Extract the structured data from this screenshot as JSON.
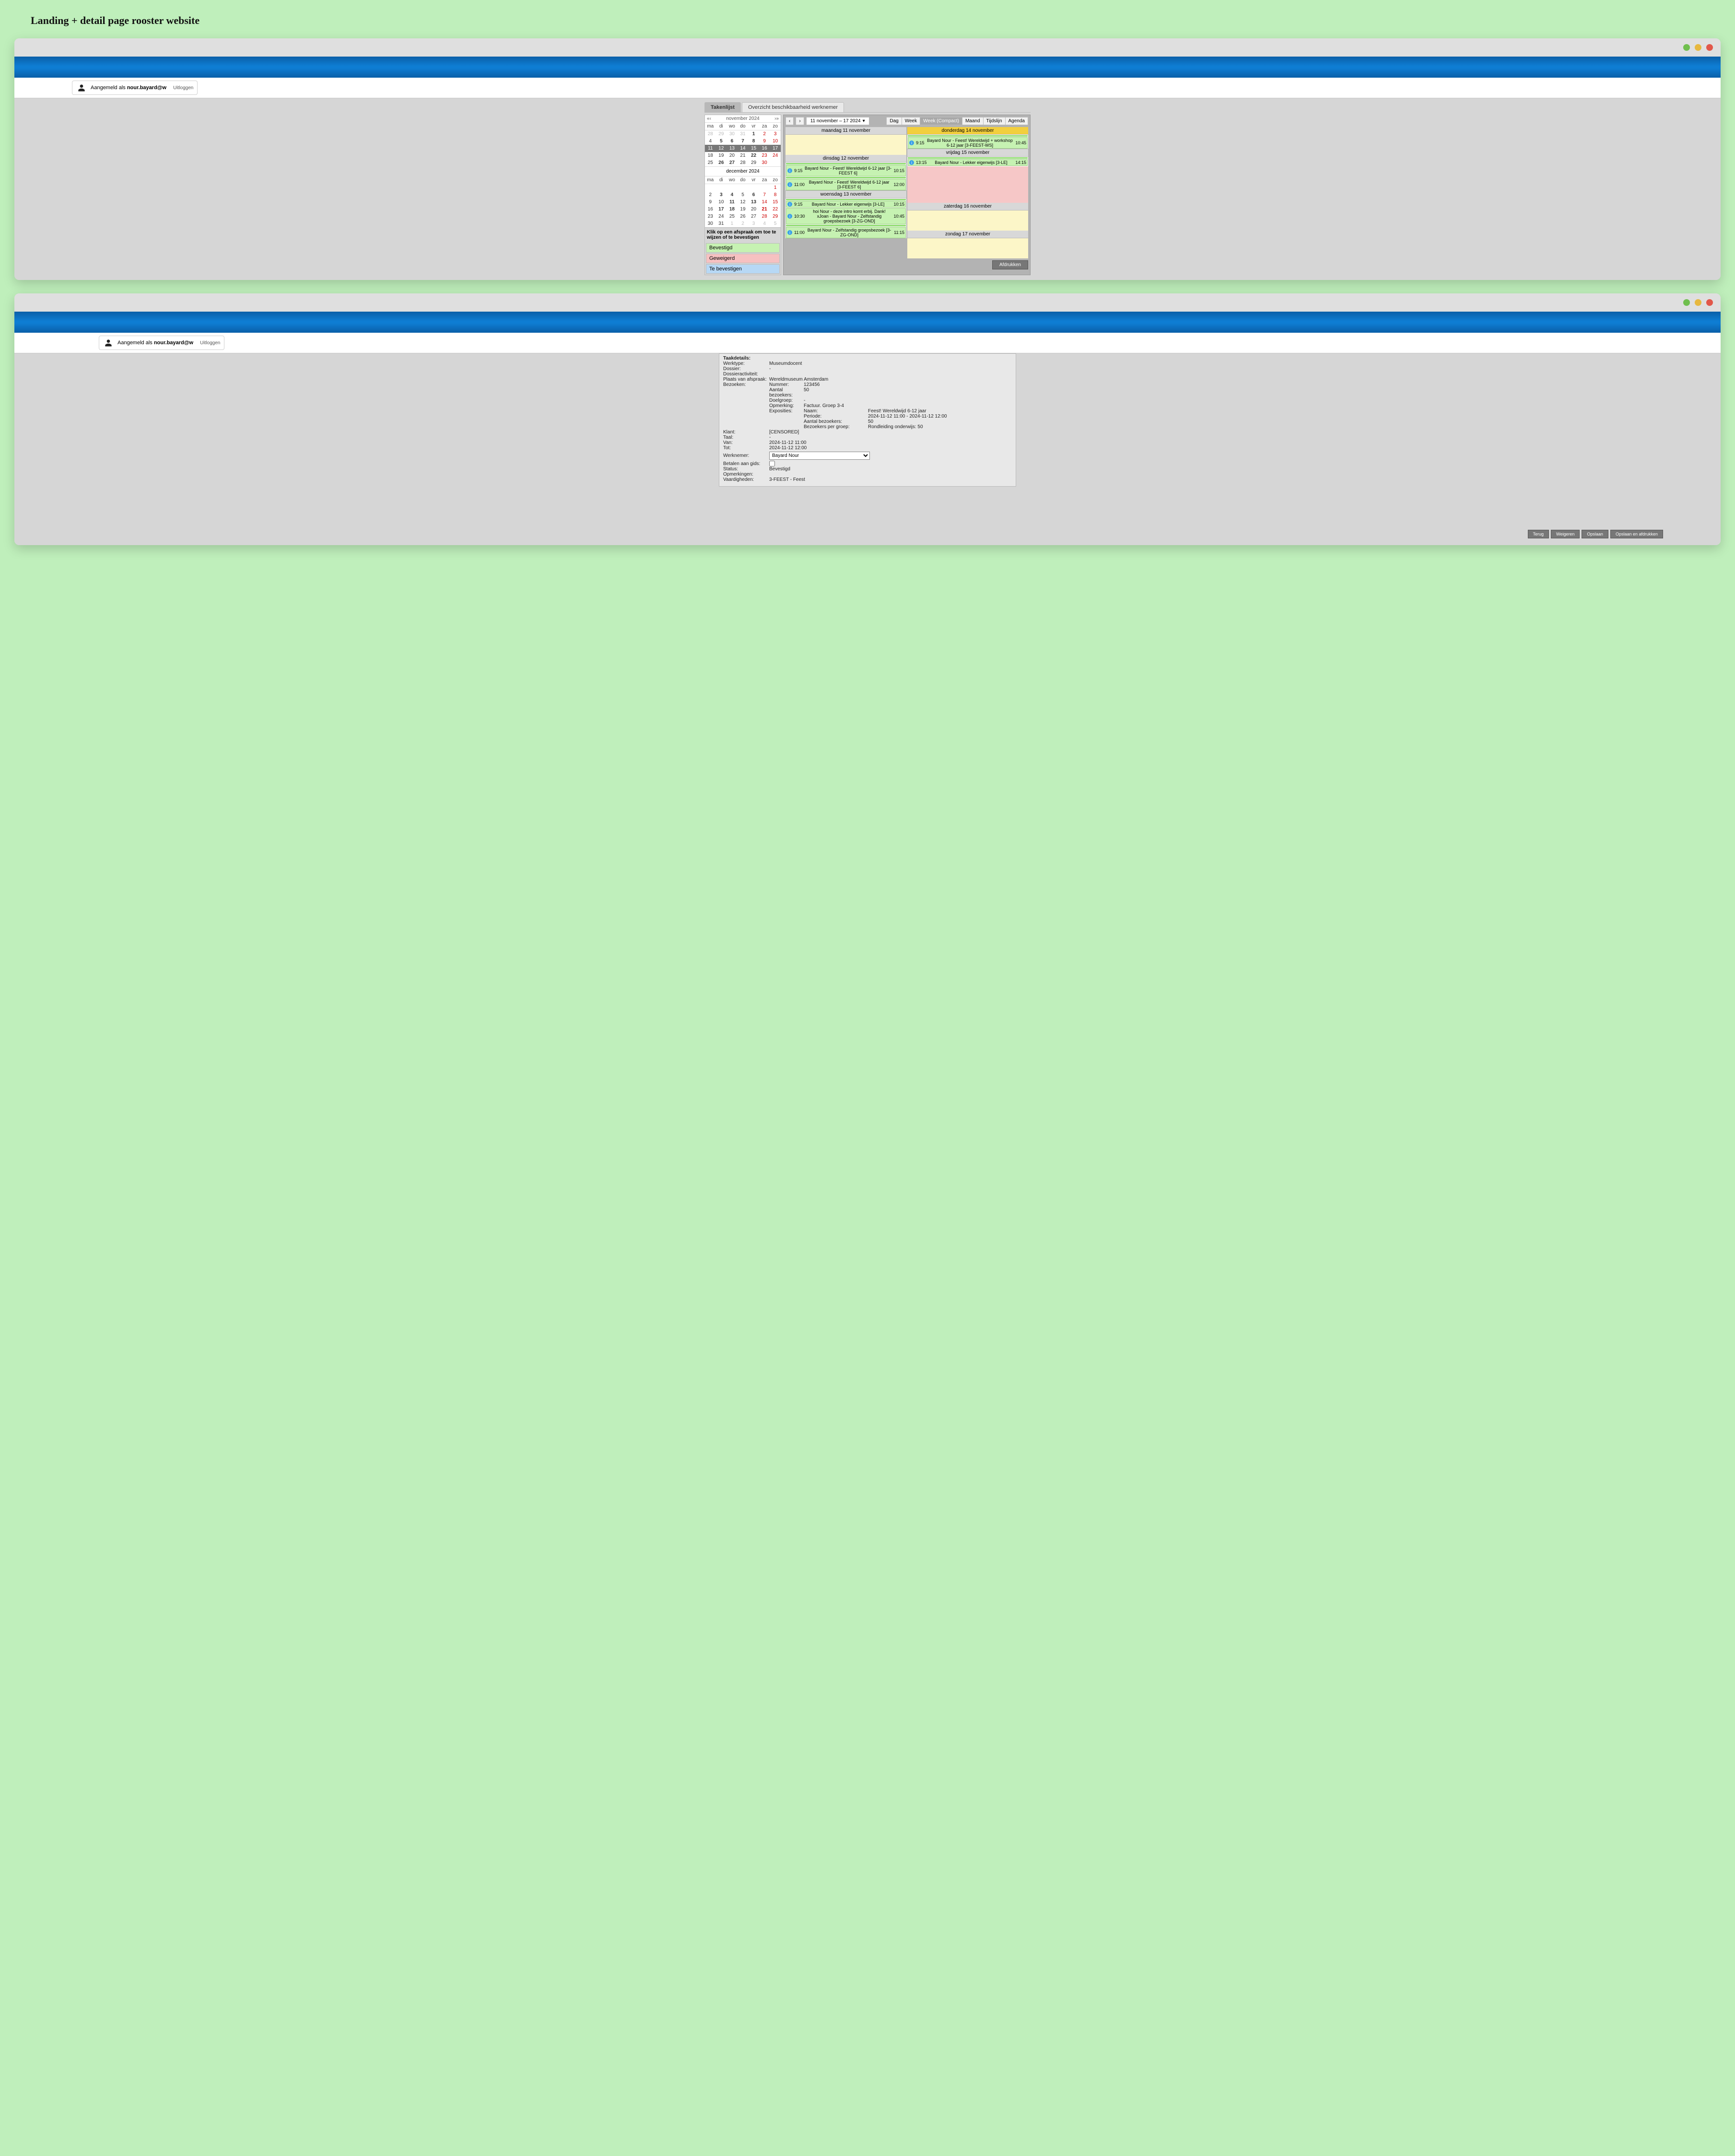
{
  "page_title": "Landing + detail page rooster website",
  "auth": {
    "logged_in_prefix": "Aangemeld als ",
    "user_display": "nour.bayard@w",
    "logout": "Uitloggen"
  },
  "tabs": {
    "tasklist": "Takenlijst",
    "availability": "Overzicht beschikbaarheid werknemer"
  },
  "mini_cal": {
    "nav_first": "«",
    "nav_prev": "‹",
    "nav_next": "›",
    "nav_last": "»",
    "nov_title": "november 2024",
    "dec_title": "december 2024",
    "dow": [
      "ma",
      "di",
      "wo",
      "do",
      "vr",
      "za",
      "zo"
    ],
    "nov_rows": [
      {
        "cells": [
          {
            "d": "28",
            "m": true
          },
          {
            "d": "29",
            "m": true
          },
          {
            "d": "30",
            "m": true
          },
          {
            "d": "31",
            "m": true
          },
          {
            "d": "1",
            "b": true
          },
          {
            "d": "2",
            "r": true
          },
          {
            "d": "3",
            "r": true
          }
        ]
      },
      {
        "cells": [
          {
            "d": "4"
          },
          {
            "d": "5",
            "b": true
          },
          {
            "d": "6",
            "b": true
          },
          {
            "d": "7",
            "b": true
          },
          {
            "d": "8",
            "b": true
          },
          {
            "d": "9",
            "r": true
          },
          {
            "d": "10",
            "r": true
          }
        ]
      },
      {
        "sel": true,
        "cells": [
          {
            "d": "11"
          },
          {
            "d": "12"
          },
          {
            "d": "13"
          },
          {
            "d": "14"
          },
          {
            "d": "15"
          },
          {
            "d": "16"
          },
          {
            "d": "17"
          }
        ]
      },
      {
        "cells": [
          {
            "d": "18"
          },
          {
            "d": "19"
          },
          {
            "d": "20"
          },
          {
            "d": "21"
          },
          {
            "d": "22",
            "b": true
          },
          {
            "d": "23",
            "r": true
          },
          {
            "d": "24",
            "r": true
          }
        ]
      },
      {
        "cells": [
          {
            "d": "25"
          },
          {
            "d": "26",
            "b": true
          },
          {
            "d": "27",
            "b": true
          },
          {
            "d": "28"
          },
          {
            "d": "29"
          },
          {
            "d": "30",
            "r": true
          },
          {
            "d": ""
          }
        ]
      }
    ],
    "dec_rows": [
      {
        "cells": [
          {
            "d": ""
          },
          {
            "d": ""
          },
          {
            "d": ""
          },
          {
            "d": ""
          },
          {
            "d": ""
          },
          {
            "d": ""
          },
          {
            "d": "1",
            "r": true
          }
        ]
      },
      {
        "cells": [
          {
            "d": "2"
          },
          {
            "d": "3",
            "b": true
          },
          {
            "d": "4",
            "b": true
          },
          {
            "d": "5"
          },
          {
            "d": "6",
            "b": true
          },
          {
            "d": "7",
            "r": true
          },
          {
            "d": "8",
            "r": true
          }
        ]
      },
      {
        "cells": [
          {
            "d": "9"
          },
          {
            "d": "10"
          },
          {
            "d": "11",
            "b": true
          },
          {
            "d": "12"
          },
          {
            "d": "13",
            "b": true
          },
          {
            "d": "14",
            "r": true
          },
          {
            "d": "15",
            "r": true
          }
        ]
      },
      {
        "cells": [
          {
            "d": "16"
          },
          {
            "d": "17",
            "b": true
          },
          {
            "d": "18",
            "b": true
          },
          {
            "d": "19"
          },
          {
            "d": "20"
          },
          {
            "d": "21",
            "r": true,
            "b": true
          },
          {
            "d": "22",
            "r": true
          }
        ]
      },
      {
        "cells": [
          {
            "d": "23"
          },
          {
            "d": "24"
          },
          {
            "d": "25"
          },
          {
            "d": "26"
          },
          {
            "d": "27"
          },
          {
            "d": "28",
            "r": true
          },
          {
            "d": "29",
            "r": true
          }
        ]
      },
      {
        "cells": [
          {
            "d": "30"
          },
          {
            "d": "31"
          },
          {
            "d": "1",
            "m": true
          },
          {
            "d": "2",
            "m": true
          },
          {
            "d": "3",
            "m": true
          },
          {
            "d": "4",
            "m": true
          },
          {
            "d": "5",
            "m": true
          }
        ]
      }
    ]
  },
  "legend": {
    "hint": "Klik op een afspraak om toe te wijzen of te bevestigen",
    "confirmed": "Bevestigd",
    "refused": "Geweigerd",
    "pending": "Te bevestigen"
  },
  "toolbar": {
    "prev": "‹",
    "next": "›",
    "range": "11 november – 17 2024",
    "dropdown": "▾",
    "views": {
      "day": "Dag",
      "week": "Week",
      "week_compact": "Week (Compact)",
      "month": "Maand",
      "timeline": "Tijdslijn",
      "agenda": "Agenda"
    }
  },
  "days": {
    "mon": {
      "head": "maandag 11 november"
    },
    "tue": {
      "head": "dinsdag 12 november",
      "e1": {
        "s": "9:15",
        "t": "Bayard Nour - Feest! Wereldwijd 6-12 jaar [3-FEEST 6]",
        "e": "10:15"
      },
      "e2": {
        "s": "11:00",
        "t": "Bayard Nour - Feest! Wereldwijd 6-12 jaar [3-FEEST 6]",
        "e": "12:00"
      }
    },
    "wed": {
      "head": "woensdag 13 november",
      "e1": {
        "s": "9:15",
        "t": "Bayard Nour - Lekker eigenwijs [3-LE]",
        "e": "10:15"
      },
      "e2": {
        "s": "10:30",
        "t": "hoi Nour - deze intro komt erbij. Dank! xJoan - Bayard Nour - Zelfstandig groepsbezoek [3-ZG-OND]",
        "e": "10:45"
      },
      "e3": {
        "s": "11:00",
        "t": "Bayard Nour - Zelfstandig groepsbezoek [3-ZG-OND]",
        "e": "11:15"
      }
    },
    "thu": {
      "head": "donderdag 14 november",
      "e1": {
        "s": "9:15",
        "t": "Bayard Nour - Feest! Wereldwijd + workshop 6-12 jaar [3-FEEST-WS]",
        "e": "10:45"
      }
    },
    "fri": {
      "head": "vrijdag 15 november",
      "e1": {
        "s": "13:15",
        "t": "Bayard Nour - Lekker eigenwijs [3-LE]",
        "e": "14:15"
      }
    },
    "sat": {
      "head": "zaterdag 16 november"
    },
    "sun": {
      "head": "zondag 17 november"
    }
  },
  "print_btn": "Afdrukken",
  "detail": {
    "title": "Taakdetails:",
    "werktype_l": "Werktype:",
    "werktype_v": "Museumdocent",
    "dossier_l": "Dossier:",
    "dossier_v": "-",
    "dossieract_l": "Dossieractiviteit:",
    "dossieract_v": "",
    "plaats_l": "Plaats van afspraak:",
    "plaats_v": "Wereldmuseum Amsterdam",
    "bezoeken_l": "Bezoeken:",
    "sub": {
      "nummer_l": "Nummer:",
      "nummer_v": "123456",
      "aantal_l": "Aantal bezoekers:",
      "aantal_v": "50",
      "doel_l": "Doelgroep:",
      "doel_v": "-",
      "opm_l": "Opmerking:",
      "opm_v": "Factuur. Groep 3-4",
      "exp_l": "Exposities:",
      "exp": {
        "naam_l": "Naam:",
        "naam_v": "Feest! Wereldwijd 6-12 jaar",
        "periode_l": "Periode:",
        "periode_v": "2024-11-12 11:00 - 2024-11-12 12:00",
        "aantal_l": "Aantal bezoekers:",
        "aantal_v": "50",
        "pergroep_l": "Bezoekers per groep:",
        "pergroep_v": "Rondleiding onderwijs: 50"
      }
    },
    "klant_l": "Klant:",
    "klant_v": "[CENSORED]",
    "taal_l": "Taal:",
    "taal_v": "-",
    "van_l": "Van:",
    "van_v": "2024-11-12 11:00",
    "tot_l": "Tot:",
    "tot_v": "2024-11-12 12:00",
    "werknemer_l": "Werknemer:",
    "werknemer_v": "Bayard Nour",
    "betalen_l": "Betalen aan gids:",
    "status_l": "Status:",
    "status_v": "Bevestigd",
    "opmerk_l": "Opmerkingen:",
    "opmerk_v": "",
    "vaard_l": "Vaardigheden:",
    "vaard_v": "3-FEEST - Feest",
    "actions": {
      "back": "Terug",
      "refuse": "Weigeren",
      "save": "Opslaan",
      "save_print": "Opslaan en afdrukken"
    }
  }
}
